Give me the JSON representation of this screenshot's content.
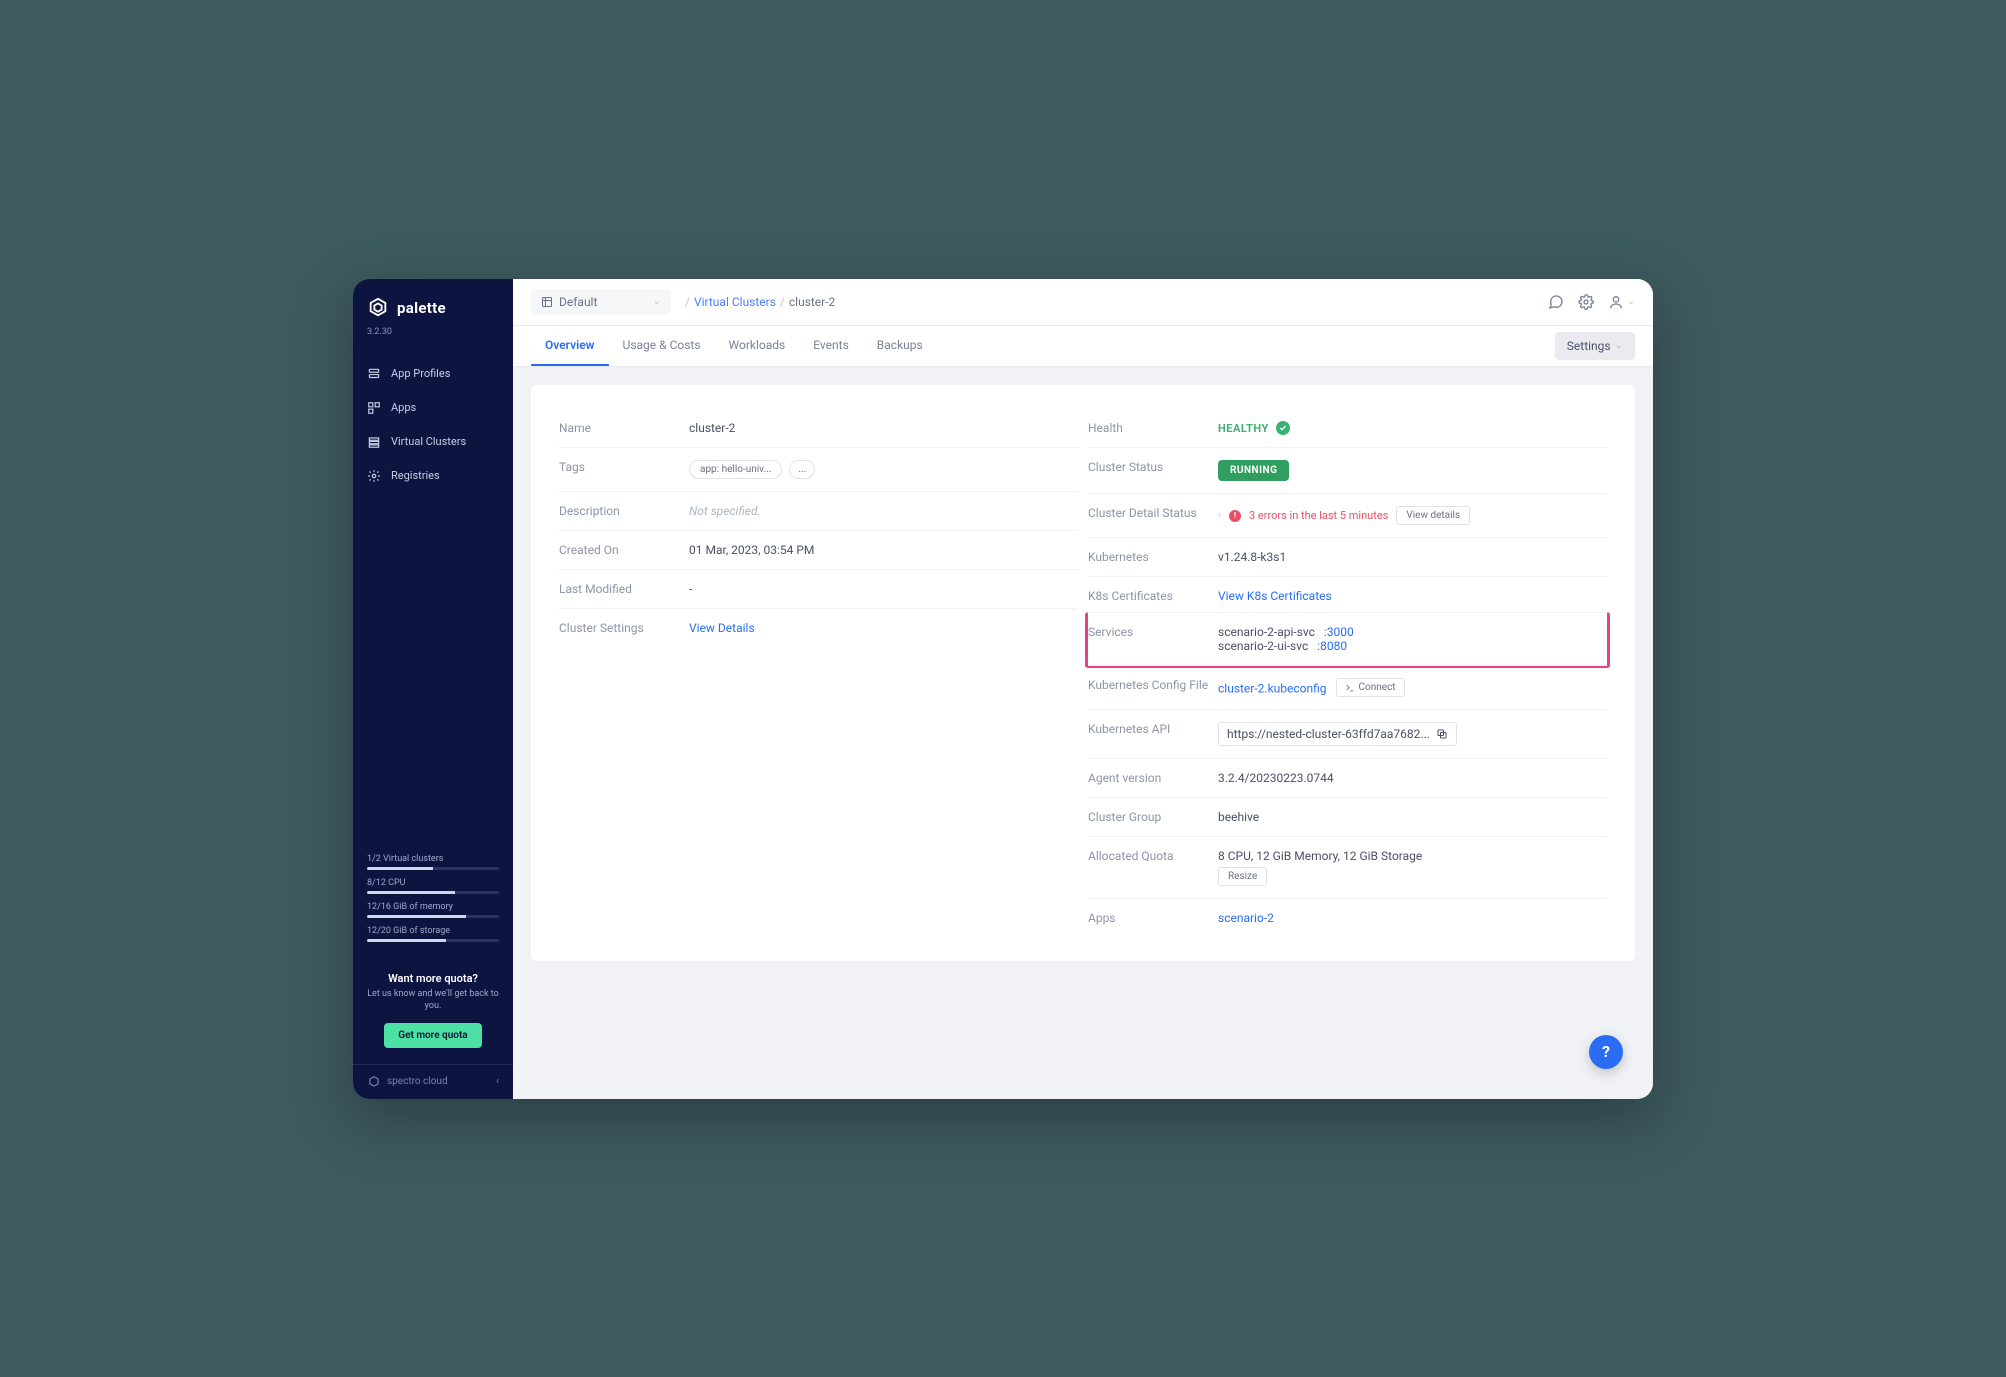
{
  "brand": {
    "name": "palette",
    "version": "3.2.30",
    "footer": "spectro cloud"
  },
  "nav": {
    "items": [
      {
        "label": "App Profiles"
      },
      {
        "label": "Apps"
      },
      {
        "label": "Virtual Clusters"
      },
      {
        "label": "Registries"
      }
    ]
  },
  "usage": {
    "vc": {
      "label": "1/2 Virtual clusters",
      "pct": 50
    },
    "cpu": {
      "label": "8/12 CPU",
      "pct": 67
    },
    "mem": {
      "label": "12/16 GiB of memory",
      "pct": 75
    },
    "stor": {
      "label": "12/20 GiB of storage",
      "pct": 60
    }
  },
  "quota": {
    "title": "Want more quota?",
    "sub": "Let us know and we'll get back to you.",
    "button": "Get more quota"
  },
  "topbar": {
    "project": "Default",
    "crumb_link": "Virtual Clusters",
    "crumb_current": "cluster-2"
  },
  "tabs": {
    "items": [
      "Overview",
      "Usage & Costs",
      "Workloads",
      "Events",
      "Backups"
    ],
    "settings": "Settings"
  },
  "left": {
    "name": {
      "label": "Name",
      "value": "cluster-2"
    },
    "tags": {
      "label": "Tags",
      "chip": "app: hello-univ...",
      "more": "..."
    },
    "description": {
      "label": "Description",
      "value": "Not specified."
    },
    "created": {
      "label": "Created On",
      "value": "01 Mar, 2023, 03:54 PM"
    },
    "modified": {
      "label": "Last Modified",
      "value": "-"
    },
    "settings": {
      "label": "Cluster Settings",
      "link": "View Details"
    }
  },
  "right": {
    "health": {
      "label": "Health",
      "value": "HEALTHY"
    },
    "status": {
      "label": "Cluster Status",
      "value": "RUNNING"
    },
    "detail": {
      "label": "Cluster Detail Status",
      "error": "3 errors in the last 5 minutes",
      "view": "View details"
    },
    "k8s": {
      "label": "Kubernetes",
      "value": "v1.24.8-k3s1"
    },
    "certs": {
      "label": "K8s Certificates",
      "link": "View K8s Certificates"
    },
    "services": {
      "label": "Services",
      "s1": {
        "name": "scenario-2-api-svc",
        "port": ":3000"
      },
      "s2": {
        "name": "scenario-2-ui-svc",
        "port": ":8080"
      }
    },
    "kubeconfig": {
      "label": "Kubernetes Config File",
      "file": "cluster-2.kubeconfig",
      "connect": "Connect"
    },
    "api": {
      "label": "Kubernetes API",
      "value": "https://nested-cluster-63ffd7aa7682..."
    },
    "agent": {
      "label": "Agent version",
      "value": "3.2.4/20230223.0744"
    },
    "group": {
      "label": "Cluster Group",
      "value": "beehive"
    },
    "quota": {
      "label": "Allocated Quota",
      "value": "8 CPU, 12 GiB Memory, 12 GiB Storage",
      "resize": "Resize"
    },
    "apps": {
      "label": "Apps",
      "link": "scenario-2"
    }
  }
}
